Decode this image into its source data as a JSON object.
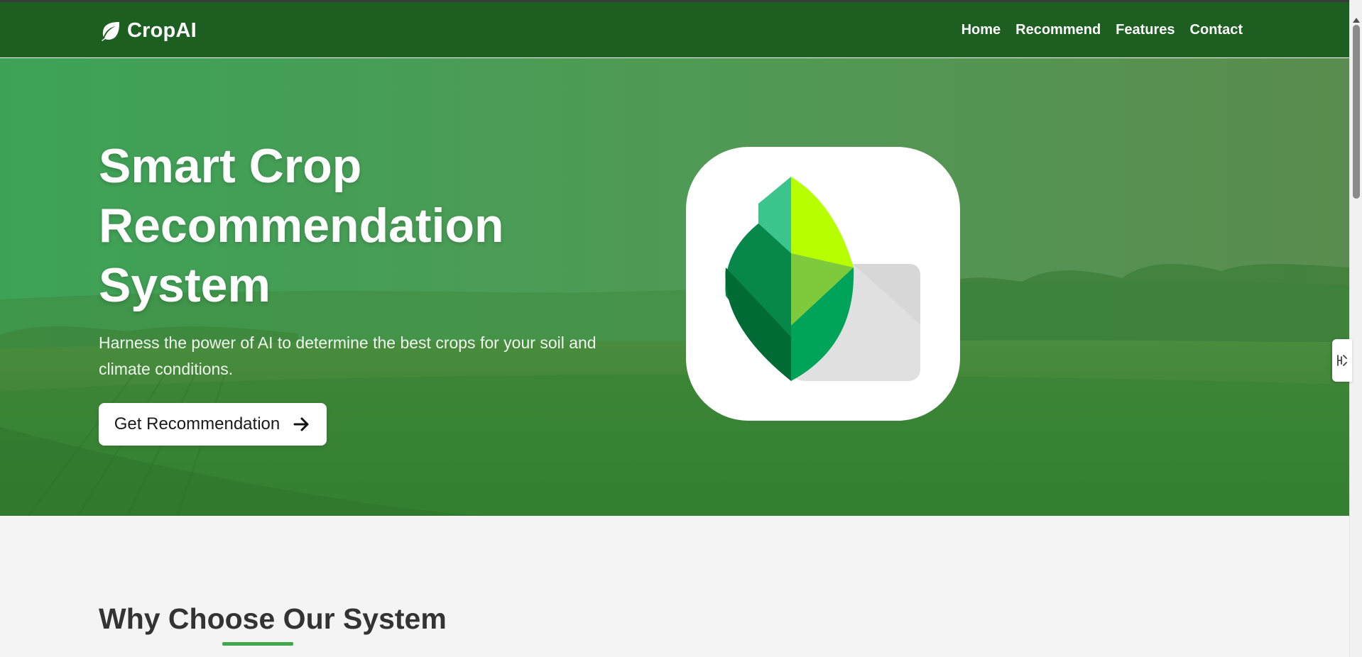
{
  "navbar": {
    "brand": "CropAI",
    "brand_icon": "leaf-icon",
    "links": [
      "Home",
      "Recommend",
      "Features",
      "Contact"
    ],
    "background": "#1d5f21"
  },
  "hero": {
    "title_lines": [
      "Smart Crop",
      "Recommendation",
      "System"
    ],
    "subtitle": "Harness the power of AI to determine the best crops for your soil and climate conditions.",
    "cta_label": "Get Recommendation",
    "cta_icon": "arrow-right-icon",
    "logo_icon": "leaf-app-logo-icon"
  },
  "features": {
    "title": "Why Choose Our System",
    "accent": "#3fa84a"
  },
  "side_tab_icon": "extension-tab-icon"
}
